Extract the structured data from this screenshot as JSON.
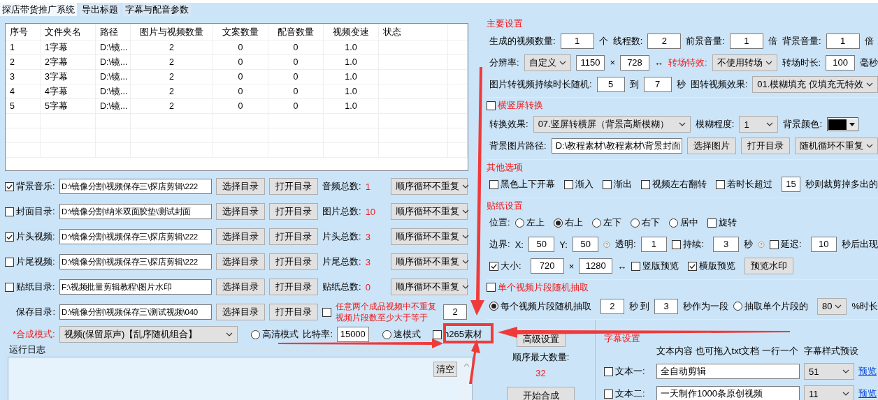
{
  "tabs": [
    {
      "label": "探店带货推广系统",
      "selected": true
    },
    {
      "label": "导出标题",
      "selected": false
    },
    {
      "label": "字幕与配音参数",
      "selected": false
    }
  ],
  "table": {
    "columns": [
      "序号",
      "文件夹名",
      "路径",
      "图片与视频数量",
      "文案数量",
      "配音数量",
      "视频变速",
      "状态"
    ],
    "rows": [
      [
        "1",
        "1字幕",
        "D:\\镜...",
        "2",
        "0",
        "0",
        "1.0"
      ],
      [
        "2",
        "2字幕",
        "D:\\镜...",
        "2",
        "0",
        "0",
        "1.0"
      ],
      [
        "3",
        "3字幕",
        "D:\\镜...",
        "2",
        "0",
        "0",
        "1.0"
      ],
      [
        "4",
        "4字幕",
        "D:\\镜...",
        "2",
        "0",
        "0",
        "1.0"
      ],
      [
        "5",
        "5字幕",
        "D:\\镜...",
        "2",
        "0",
        "0",
        "1.0"
      ]
    ]
  },
  "dir_rows": [
    {
      "checked": true,
      "label": "背景音乐:",
      "path": "D:\\镜像分割\\视频保存三\\探店剪辑\\222",
      "buttons": [
        "选择目录",
        "打开目录"
      ],
      "count_label": "音频总数:",
      "count": "1",
      "order": "顺序循环不重复"
    },
    {
      "checked": false,
      "label": "封面目录:",
      "path": "D:\\镜像分割\\纳米双面胶垫\\测试封面",
      "buttons": [
        "选择目录",
        "打开目录"
      ],
      "count_label": "图片总数:",
      "count": "10",
      "order": "顺序循环不重复"
    },
    {
      "checked": true,
      "label": "片头视频:",
      "path": "D:\\镜像分割\\视频保存三\\探店剪辑\\222",
      "buttons": [
        "选择目录",
        "打开目录"
      ],
      "count_label": "片头总数:",
      "count": "3",
      "order": "顺序循环不重复"
    },
    {
      "checked": false,
      "label": "片尾视频:",
      "path": "D:\\镜像分割\\视频保存三\\探店剪辑\\222",
      "buttons": [
        "选择目录",
        "打开目录"
      ],
      "count_label": "片尾总数:",
      "count": "3",
      "order": "顺序循环不重复"
    },
    {
      "checked": false,
      "label": "贴纸目录:",
      "path": "F:\\视频批量剪辑教程\\图片水印",
      "buttons": [
        "选择目录",
        "打开目录"
      ],
      "count_label": "贴纸总数:",
      "count": "0",
      "order": "顺序循环不重复"
    }
  ],
  "save_row": {
    "label": "保存目录:",
    "path": "D:\\镜像分割\\视频保存三\\测试视频\\040",
    "buttons": [
      "选择目录",
      "打开目录"
    ],
    "unique_checked": false,
    "unique_note": "任意两个成品视频中不重复视频片段数至少大于等于",
    "unique_value": "2"
  },
  "mode_row": {
    "label": "*合成模式:",
    "mode": "视频(保留原声)【乱序随机组合】",
    "hd": {
      "label": "高清模式",
      "selected": false
    },
    "bitrate_label": "比特率:",
    "bitrate": "15000",
    "fast": {
      "label": "速模式",
      "selected": false
    },
    "h265": {
      "label": "h265素材",
      "checked": false
    }
  },
  "log": {
    "title": "运行日志",
    "clear_button": "清空"
  },
  "sections": [
    {
      "title": "主要设置",
      "rows": [
        {
          "items": [
            {
              "kind": "label",
              "text": "生成的视频数量:"
            },
            {
              "kind": "field",
              "text": "1"
            },
            {
              "kind": "label",
              "text": "个"
            },
            {
              "kind": "label",
              "text": "线程数:"
            },
            {
              "kind": "field",
              "text": "2"
            },
            {
              "kind": "label",
              "text": "前景音量:"
            },
            {
              "kind": "field",
              "text": "1"
            },
            {
              "kind": "label",
              "text": "倍"
            },
            {
              "kind": "label",
              "text": "背景音量:"
            },
            {
              "kind": "field",
              "text": "1"
            },
            {
              "kind": "label",
              "text": "倍"
            }
          ]
        },
        {
          "items": [
            {
              "kind": "label",
              "text": "分辨率:"
            },
            {
              "kind": "dropdown",
              "text": "自定义"
            },
            {
              "kind": "field",
              "text": "1150"
            },
            {
              "kind": "label",
              "text": "×"
            },
            {
              "kind": "field",
              "text": "728"
            },
            {
              "kind": "label",
              "text": "↔"
            },
            {
              "kind": "accent_label",
              "text": "转场特效:"
            },
            {
              "kind": "dropdown",
              "text": "不使用转场"
            },
            {
              "kind": "label",
              "text": "转场时长:"
            },
            {
              "kind": "field",
              "text": "100"
            },
            {
              "kind": "label",
              "text": "毫秒"
            }
          ]
        },
        {
          "items": [
            {
              "kind": "label",
              "text": "图片转视频持续时长随机:"
            },
            {
              "kind": "field",
              "text": "5"
            },
            {
              "kind": "label",
              "text": "到"
            },
            {
              "kind": "field",
              "text": "7"
            },
            {
              "kind": "label",
              "text": "秒"
            },
            {
              "kind": "label",
              "text": "图转视频效果:"
            },
            {
              "kind": "dropdown",
              "text": "01.模糊填充 仅填充无特效"
            }
          ]
        }
      ]
    },
    {
      "title": "横竖屏转换",
      "checked": false,
      "rows": [
        {
          "items": [
            {
              "kind": "label",
              "text": "转换效果:"
            },
            {
              "kind": "dropdown",
              "text": "07.竖屏转横屏（背景高斯模糊）"
            },
            {
              "kind": "label",
              "text": "模糊程度:"
            },
            {
              "kind": "dropdown",
              "text": "1"
            },
            {
              "kind": "label",
              "text": "背景颜色:"
            },
            {
              "kind": "color_picker",
              "color": "#000000"
            }
          ]
        },
        {
          "items": [
            {
              "kind": "label",
              "text": "背景图片路径:"
            },
            {
              "kind": "field",
              "text": "D:\\教程素材\\教程素材\\背景封面"
            },
            {
              "kind": "button",
              "text": "选择图片"
            },
            {
              "kind": "button",
              "text": "打开目录"
            },
            {
              "kind": "dropdown",
              "text": "随机循环不重复"
            }
          ]
        }
      ]
    },
    {
      "title": "其他选项",
      "rows": [
        {
          "items": [
            {
              "kind": "checkbox",
              "text": "黑色上下开幕",
              "checked": false
            },
            {
              "kind": "checkbox",
              "text": "渐入",
              "checked": false
            },
            {
              "kind": "checkbox",
              "text": "渐出",
              "checked": false
            },
            {
              "kind": "checkbox",
              "text": "视频左右翻转",
              "checked": false
            },
            {
              "kind": "checkbox",
              "text": "若时长超过",
              "checked": false
            },
            {
              "kind": "field",
              "text": "15"
            },
            {
              "kind": "label",
              "text": "秒则裁剪掉多出的"
            }
          ]
        }
      ]
    },
    {
      "title": "贴纸设置",
      "rows": [
        {
          "items": [
            {
              "kind": "label",
              "text": "位置:"
            },
            {
              "kind": "radio",
              "text": "左上",
              "selected": false
            },
            {
              "kind": "radio",
              "text": "右上",
              "selected": true
            },
            {
              "kind": "radio",
              "text": "左下",
              "selected": false
            },
            {
              "kind": "radio",
              "text": "右下",
              "selected": false
            },
            {
              "kind": "radio",
              "text": "居中",
              "selected": false
            },
            {
              "kind": "checkbox",
              "text": "旋转",
              "checked": false
            }
          ]
        },
        {
          "items": [
            {
              "kind": "label",
              "text": "边界:"
            },
            {
              "kind": "label",
              "text": "X:"
            },
            {
              "kind": "field",
              "text": "50"
            },
            {
              "kind": "label",
              "text": "Y:"
            },
            {
              "kind": "field",
              "text": "50"
            },
            {
              "kind": "help"
            },
            {
              "kind": "label",
              "text": "透明:"
            },
            {
              "kind": "field",
              "text": "1"
            },
            {
              "kind": "checkbox",
              "text": "持续:",
              "checked": false
            },
            {
              "kind": "field",
              "text": "3"
            },
            {
              "kind": "label",
              "text": "秒"
            },
            {
              "kind": "help"
            },
            {
              "kind": "checkbox",
              "text": "延迟:",
              "checked": false
            },
            {
              "kind": "field",
              "text": "10"
            },
            {
              "kind": "label",
              "text": "秒后出现"
            }
          ]
        },
        {
          "items": [
            {
              "kind": "checkbox",
              "text": "大小:",
              "checked": true
            },
            {
              "kind": "field",
              "text": "720"
            },
            {
              "kind": "label",
              "text": "×"
            },
            {
              "kind": "field",
              "text": "1280"
            },
            {
              "kind": "label",
              "text": "↔"
            },
            {
              "kind": "checkbox",
              "text": "竖版预览",
              "checked": false
            },
            {
              "kind": "checkbox",
              "text": "横版预览",
              "checked": true
            },
            {
              "kind": "button",
              "text": "预览水印"
            }
          ]
        }
      ]
    },
    {
      "title": "单个视频片段随机抽取",
      "checked": false,
      "rows": [
        {
          "items": [
            {
              "kind": "radio",
              "text": "每个视频片段随机抽取",
              "selected": true
            },
            {
              "kind": "field",
              "text": "2"
            },
            {
              "kind": "label",
              "text": "秒 到"
            },
            {
              "kind": "field",
              "text": "3"
            },
            {
              "kind": "label",
              "text": "秒作为一段"
            },
            {
              "kind": "radio",
              "text": "抽取单个片段的",
              "selected": false
            },
            {
              "kind": "dropdown",
              "text": "80"
            },
            {
              "kind": "label",
              "text": "%时长"
            }
          ]
        }
      ]
    }
  ],
  "actions": {
    "advanced_button": "高级设置",
    "max_label": "顺序最大数量:",
    "max_value": "32",
    "start_button": "开始合成"
  },
  "subtitles": {
    "title": "字幕设置",
    "header_text": "文本内容 也可拖入txt文档 一行一个",
    "header_style": "字幕样式预设",
    "rows": [
      {
        "label": "文本一:",
        "checked": false,
        "text": "全自动剪辑",
        "style": "51",
        "link": "预览"
      },
      {
        "label": "文本二:",
        "checked": false,
        "text": "一天制作1000条原创视频",
        "style": "11",
        "link": "预览"
      }
    ]
  }
}
